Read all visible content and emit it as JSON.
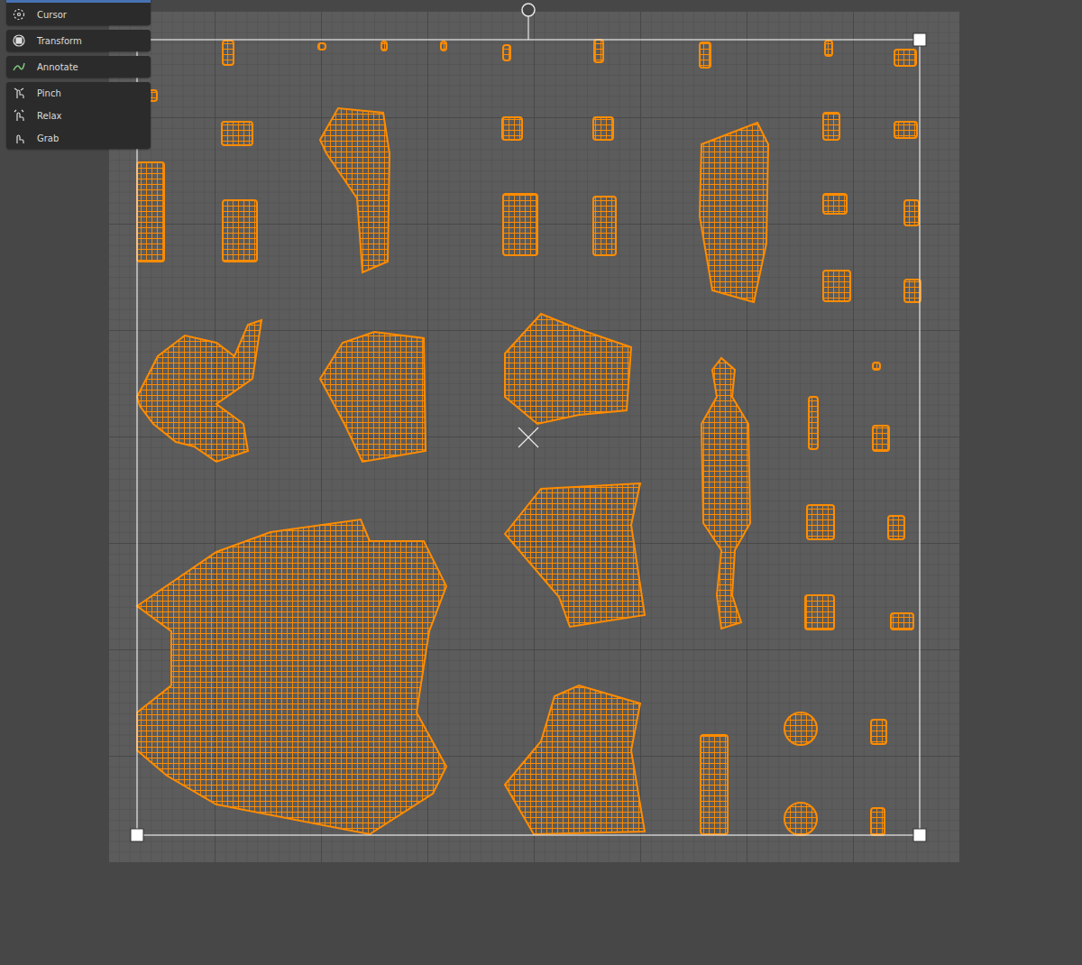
{
  "toolbar": {
    "groups": [
      {
        "tools": [
          {
            "label": "",
            "kind": "select",
            "selected": true
          },
          {
            "label": "Cursor",
            "kind": "cursor",
            "selected": false
          }
        ]
      },
      {
        "tools": [
          {
            "label": "Transform",
            "kind": "transform",
            "selected": false
          }
        ]
      },
      {
        "tools": [
          {
            "label": "Annotate",
            "kind": "annotate",
            "selected": false
          }
        ]
      },
      {
        "tools": [
          {
            "label": "Pinch",
            "kind": "pinch",
            "selected": false
          },
          {
            "label": "Relax",
            "kind": "relax",
            "selected": false
          },
          {
            "label": "Grab",
            "kind": "grab",
            "selected": false
          }
        ]
      }
    ]
  }
}
